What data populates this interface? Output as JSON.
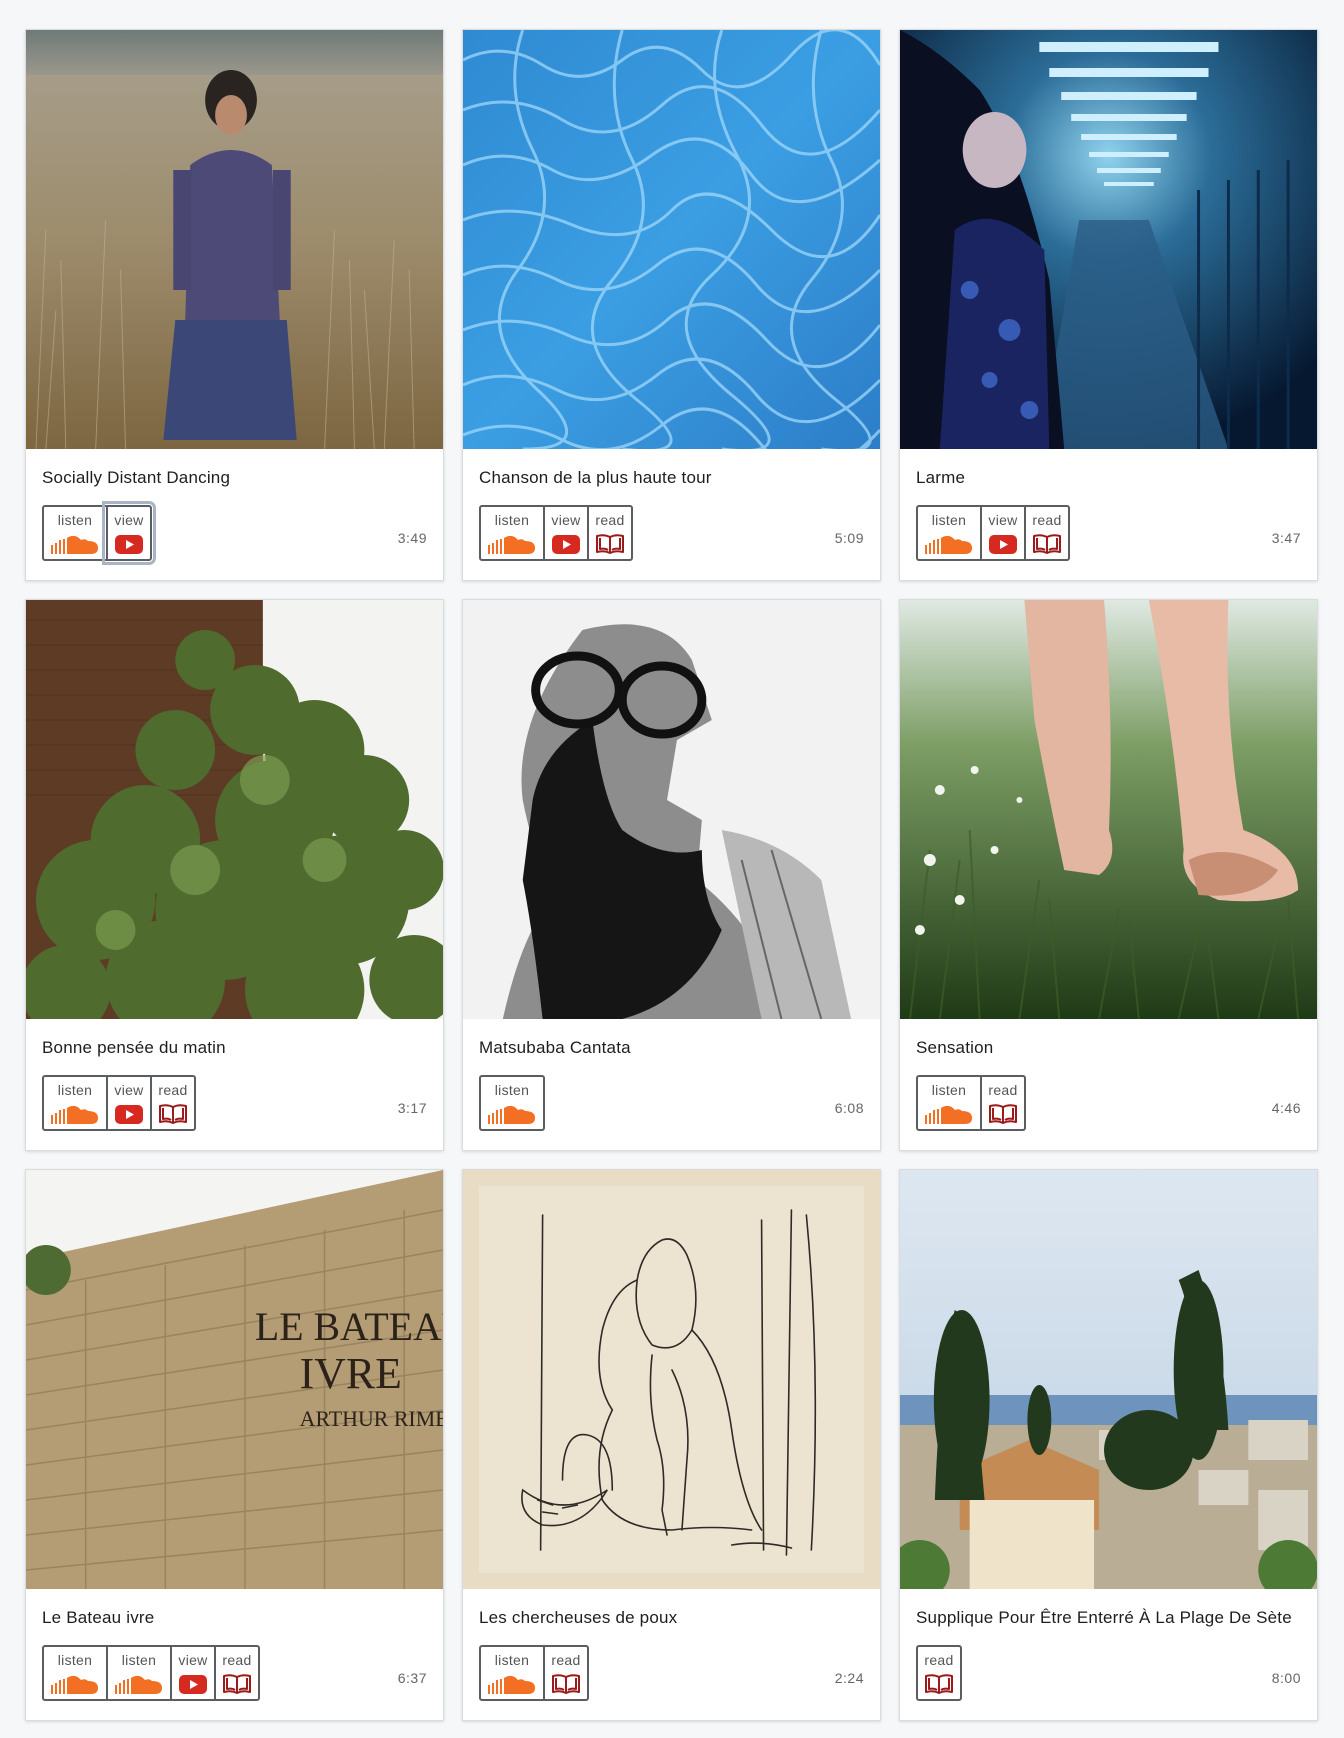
{
  "link_labels": {
    "listen": "listen",
    "view": "view",
    "read": "read"
  },
  "colors": {
    "soundcloud": "#f26f23",
    "youtube": "#d62a21",
    "book": "#9b1b1b"
  },
  "cards": [
    {
      "title": "Socially Distant Dancing",
      "duration": "3:49",
      "image": "woman in wheat field",
      "links": [
        "listen",
        "view"
      ]
    },
    {
      "title": "Chanson de la plus haute tour",
      "duration": "5:09",
      "image": "pool water",
      "links": [
        "listen",
        "view",
        "read"
      ]
    },
    {
      "title": "Larme",
      "duration": "3:47",
      "image": "woman in blue tunnel",
      "links": [
        "listen",
        "view",
        "read"
      ]
    },
    {
      "title": "Bonne pensée du matin",
      "duration": "3:17",
      "image": "tree by brick wall",
      "links": [
        "listen",
        "view",
        "read"
      ]
    },
    {
      "title": "Matsubaba Cantata",
      "duration": "6:08",
      "image": "charcoal portrait",
      "links": [
        "listen"
      ]
    },
    {
      "title": "Sensation",
      "duration": "4:46",
      "image": "bare feet in grass",
      "links": [
        "listen",
        "read"
      ]
    },
    {
      "title": "Le Bateau ivre",
      "duration": "6:37",
      "image": "poem wall",
      "image_text": [
        "LE BATEAU",
        "IVRE",
        "ARTHUR RIMBAUD"
      ],
      "links": [
        "listen",
        "listen",
        "view",
        "read"
      ]
    },
    {
      "title": "Les chercheuses de poux",
      "duration": "2:24",
      "image": "ink sketch",
      "links": [
        "listen",
        "read"
      ]
    },
    {
      "title": "Supplique Pour Être Enterré À La Plage De Sète",
      "duration": "8:00",
      "image": "seaside cemetery",
      "links": [
        "read"
      ]
    }
  ]
}
